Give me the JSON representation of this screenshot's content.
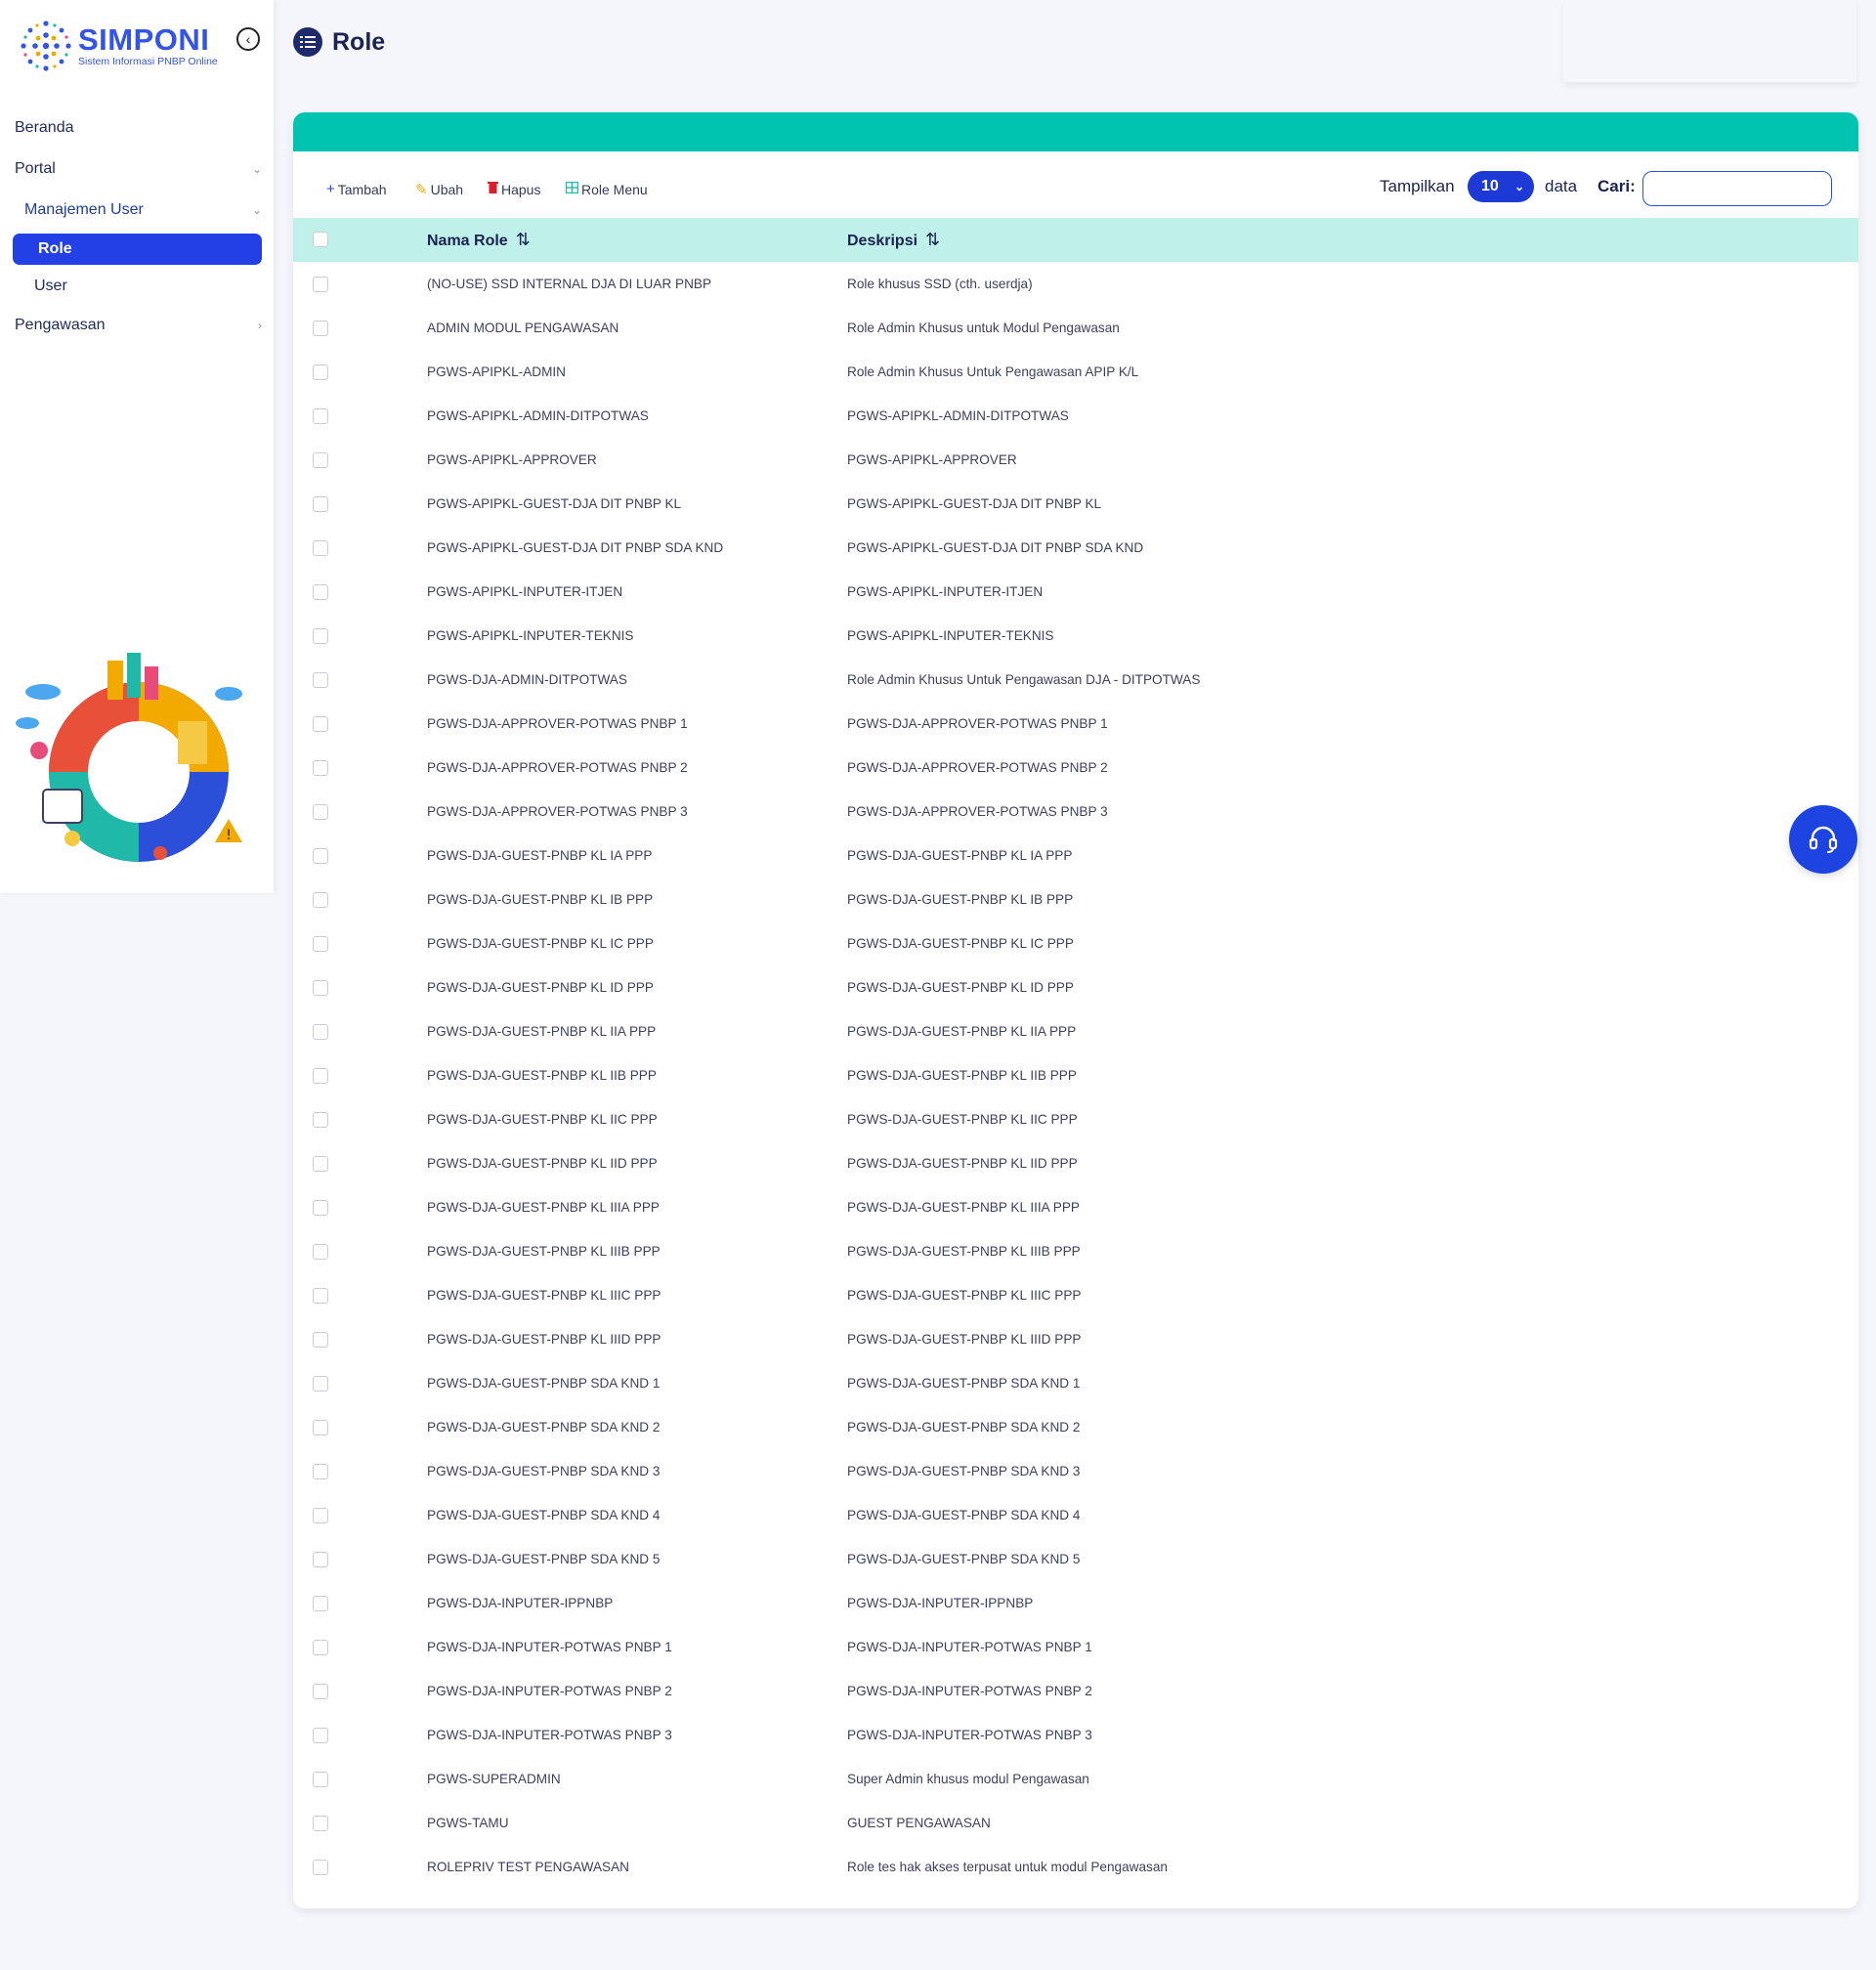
{
  "brand": {
    "title": "SIMPONI",
    "subtitle": "Sistem Informasi PNBP Online"
  },
  "sidebar": {
    "items": [
      {
        "label": "Beranda"
      },
      {
        "label": "Portal"
      },
      {
        "label": "Manajemen User"
      },
      {
        "label": "Role"
      },
      {
        "label": "User"
      },
      {
        "label": "Pengawasan"
      }
    ]
  },
  "page": {
    "title": "Role"
  },
  "toolbar": {
    "add_label": "Tambah",
    "edit_label": "Ubah",
    "delete_label": "Hapus",
    "role_menu_label": "Role Menu",
    "show_label": "Tampilkan",
    "page_size": "10",
    "data_label": "data",
    "search_label": "Cari:",
    "search_value": ""
  },
  "table": {
    "headers": {
      "name": "Nama Role",
      "description": "Deskripsi"
    },
    "rows": [
      {
        "name": "(NO-USE) SSD INTERNAL DJA DI LUAR PNBP",
        "description": "Role khusus SSD (cth. userdja)"
      },
      {
        "name": "ADMIN MODUL PENGAWASAN",
        "description": "Role Admin Khusus untuk Modul Pengawasan"
      },
      {
        "name": "PGWS-APIPKL-ADMIN",
        "description": "Role Admin Khusus Untuk Pengawasan APIP K/L"
      },
      {
        "name": "PGWS-APIPKL-ADMIN-DITPOTWAS",
        "description": "PGWS-APIPKL-ADMIN-DITPOTWAS"
      },
      {
        "name": "PGWS-APIPKL-APPROVER",
        "description": "PGWS-APIPKL-APPROVER"
      },
      {
        "name": "PGWS-APIPKL-GUEST-DJA DIT PNBP KL",
        "description": "PGWS-APIPKL-GUEST-DJA DIT PNBP KL"
      },
      {
        "name": "PGWS-APIPKL-GUEST-DJA DIT PNBP SDA KND",
        "description": "PGWS-APIPKL-GUEST-DJA DIT PNBP SDA KND"
      },
      {
        "name": "PGWS-APIPKL-INPUTER-ITJEN",
        "description": "PGWS-APIPKL-INPUTER-ITJEN"
      },
      {
        "name": "PGWS-APIPKL-INPUTER-TEKNIS",
        "description": "PGWS-APIPKL-INPUTER-TEKNIS"
      },
      {
        "name": "PGWS-DJA-ADMIN-DITPOTWAS",
        "description": "Role Admin Khusus Untuk Pengawasan DJA - DITPOTWAS"
      },
      {
        "name": "PGWS-DJA-APPROVER-POTWAS PNBP 1",
        "description": "PGWS-DJA-APPROVER-POTWAS PNBP 1"
      },
      {
        "name": "PGWS-DJA-APPROVER-POTWAS PNBP 2",
        "description": "PGWS-DJA-APPROVER-POTWAS PNBP 2"
      },
      {
        "name": "PGWS-DJA-APPROVER-POTWAS PNBP 3",
        "description": "PGWS-DJA-APPROVER-POTWAS PNBP 3"
      },
      {
        "name": "PGWS-DJA-GUEST-PNBP KL IA PPP",
        "description": "PGWS-DJA-GUEST-PNBP KL IA PPP"
      },
      {
        "name": "PGWS-DJA-GUEST-PNBP KL IB PPP",
        "description": "PGWS-DJA-GUEST-PNBP KL IB PPP"
      },
      {
        "name": "PGWS-DJA-GUEST-PNBP KL IC PPP",
        "description": "PGWS-DJA-GUEST-PNBP KL IC PPP"
      },
      {
        "name": "PGWS-DJA-GUEST-PNBP KL ID PPP",
        "description": "PGWS-DJA-GUEST-PNBP KL ID PPP"
      },
      {
        "name": "PGWS-DJA-GUEST-PNBP KL IIA PPP",
        "description": "PGWS-DJA-GUEST-PNBP KL IIA PPP"
      },
      {
        "name": "PGWS-DJA-GUEST-PNBP KL IIB PPP",
        "description": "PGWS-DJA-GUEST-PNBP KL IIB PPP"
      },
      {
        "name": "PGWS-DJA-GUEST-PNBP KL IIC PPP",
        "description": "PGWS-DJA-GUEST-PNBP KL IIC PPP"
      },
      {
        "name": "PGWS-DJA-GUEST-PNBP KL IID PPP",
        "description": "PGWS-DJA-GUEST-PNBP KL IID PPP"
      },
      {
        "name": "PGWS-DJA-GUEST-PNBP KL IIIA PPP",
        "description": "PGWS-DJA-GUEST-PNBP KL IIIA PPP"
      },
      {
        "name": "PGWS-DJA-GUEST-PNBP KL IIIB PPP",
        "description": "PGWS-DJA-GUEST-PNBP KL IIIB PPP"
      },
      {
        "name": "PGWS-DJA-GUEST-PNBP KL IIIC PPP",
        "description": "PGWS-DJA-GUEST-PNBP KL IIIC PPP"
      },
      {
        "name": "PGWS-DJA-GUEST-PNBP KL IIID PPP",
        "description": "PGWS-DJA-GUEST-PNBP KL IIID PPP"
      },
      {
        "name": "PGWS-DJA-GUEST-PNBP SDA KND 1",
        "description": "PGWS-DJA-GUEST-PNBP SDA KND 1"
      },
      {
        "name": "PGWS-DJA-GUEST-PNBP SDA KND 2",
        "description": "PGWS-DJA-GUEST-PNBP SDA KND 2"
      },
      {
        "name": "PGWS-DJA-GUEST-PNBP SDA KND 3",
        "description": "PGWS-DJA-GUEST-PNBP SDA KND 3"
      },
      {
        "name": "PGWS-DJA-GUEST-PNBP SDA KND 4",
        "description": "PGWS-DJA-GUEST-PNBP SDA KND 4"
      },
      {
        "name": "PGWS-DJA-GUEST-PNBP SDA KND 5",
        "description": "PGWS-DJA-GUEST-PNBP SDA KND 5"
      },
      {
        "name": "PGWS-DJA-INPUTER-IPPNBP",
        "description": "PGWS-DJA-INPUTER-IPPNBP"
      },
      {
        "name": "PGWS-DJA-INPUTER-POTWAS PNBP 1",
        "description": "PGWS-DJA-INPUTER-POTWAS PNBP 1"
      },
      {
        "name": "PGWS-DJA-INPUTER-POTWAS PNBP 2",
        "description": "PGWS-DJA-INPUTER-POTWAS PNBP 2"
      },
      {
        "name": "PGWS-DJA-INPUTER-POTWAS PNBP 3",
        "description": "PGWS-DJA-INPUTER-POTWAS PNBP 3"
      },
      {
        "name": "PGWS-SUPERADMIN",
        "description": "Super Admin khusus modul Pengawasan"
      },
      {
        "name": "PGWS-TAMU",
        "description": "GUEST PENGAWASAN"
      },
      {
        "name": "ROLEPRIV TEST PENGAWASAN",
        "description": "Role tes hak akses terpusat untuk modul Pengawasan"
      }
    ]
  },
  "colors": {
    "brand_blue": "#3454e8",
    "active_blue": "#2340e6",
    "teal_band": "#00c4b0",
    "header_row": "#bff0ea",
    "title_navy": "#1b2350"
  },
  "icons": {
    "collapse": "chevron-left-circle-icon",
    "page": "list-icon",
    "add": "plus-icon",
    "edit": "edit-icon",
    "delete": "trash-icon",
    "role_menu": "grid-icon",
    "sort": "sort-arrows-icon",
    "support": "headset-icon"
  }
}
